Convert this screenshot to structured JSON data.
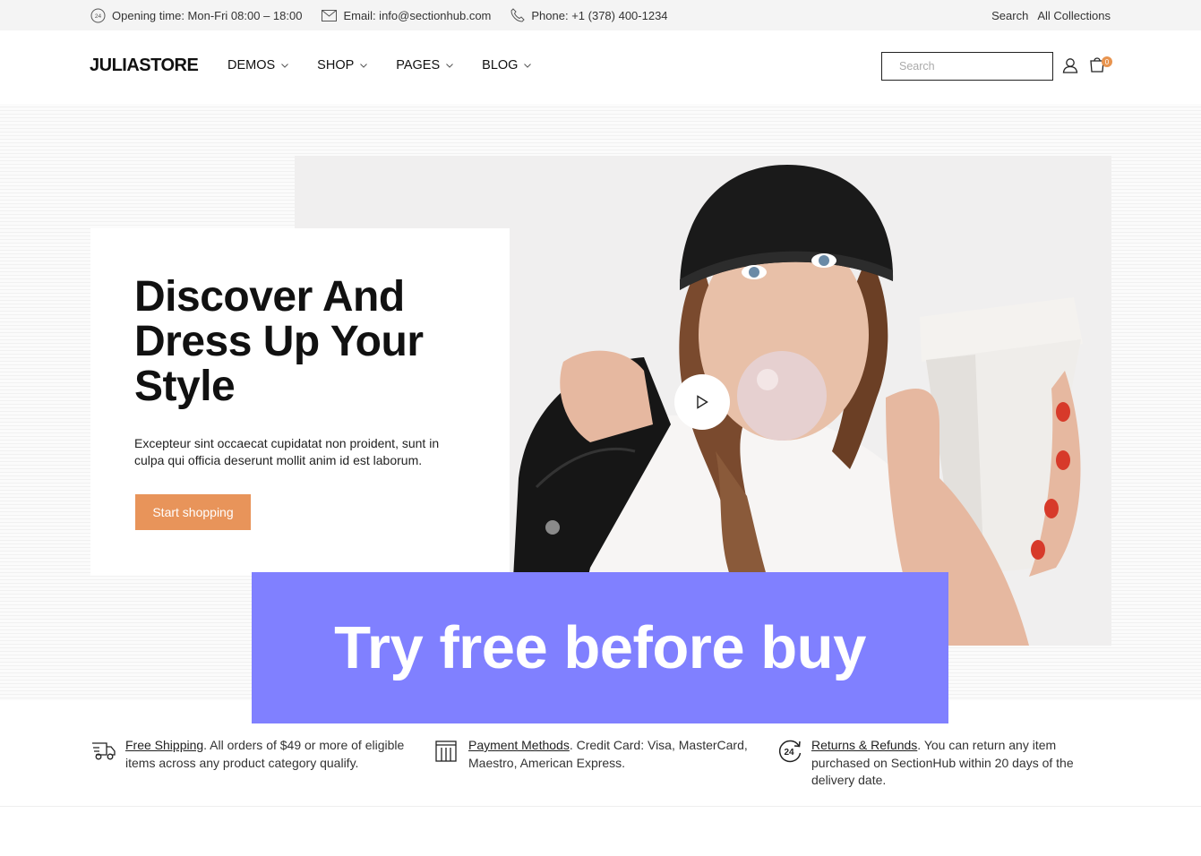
{
  "topbar": {
    "opening": "Opening time: Mon-Fri 08:00 – 18:00",
    "email": "Email: info@sectionhub.com",
    "phone": "Phone: +1 (378) 400-1234",
    "search_link": "Search",
    "collections_link": "All Collections"
  },
  "header": {
    "logo": "JULIASTORE",
    "nav": [
      {
        "label": "DEMOS"
      },
      {
        "label": "SHOP"
      },
      {
        "label": "PAGES"
      },
      {
        "label": "BLOG"
      }
    ],
    "search_placeholder": "Search",
    "cart_count": "0"
  },
  "hero": {
    "title": "Discover And Dress Up Your Style",
    "text": "Excepteur sint occaecat cupidatat non proident, sunt in culpa qui officia deserunt mollit anim id est laborum.",
    "button": "Start shopping"
  },
  "promo": {
    "text": "Try free before buy",
    "color": "#8080ff"
  },
  "features": [
    {
      "icon": "truck-icon",
      "link": "Free Shipping",
      "text": ". All orders of $49 or more of eligible items across any product category qualify."
    },
    {
      "icon": "payment-icon",
      "link": "Payment Methods",
      "text": ". Credit Card: Visa, MasterCard, Maestro, American Express."
    },
    {
      "icon": "24h-returns-icon",
      "link": "Returns & Refunds",
      "text": ". You can return any item purchased on SectionHub within 20 days of the delivery date."
    }
  ],
  "colors": {
    "accent": "#e8945a",
    "promo": "#8080ff",
    "topbar_bg": "#f4f4f4"
  }
}
